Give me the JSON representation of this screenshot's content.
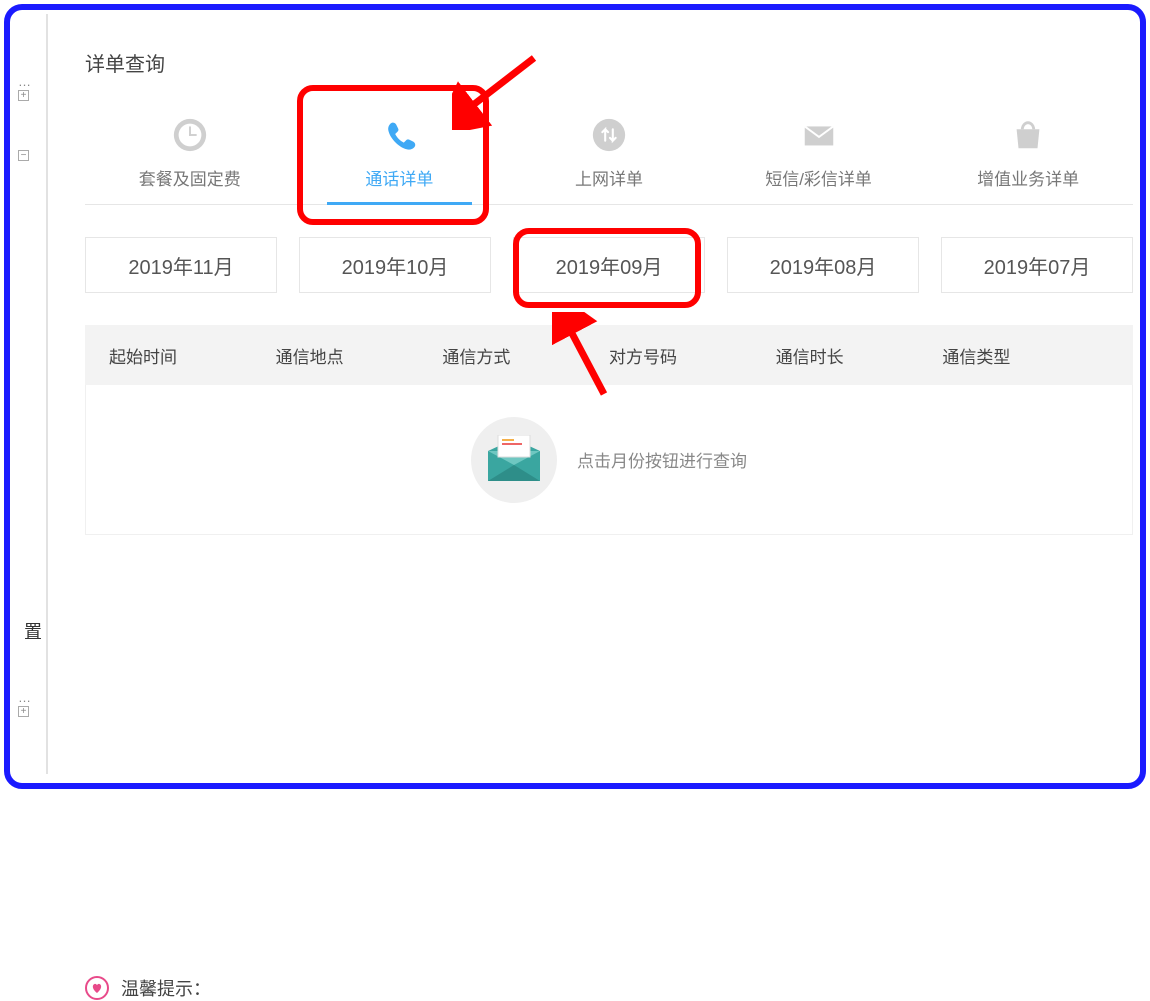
{
  "page_title": "详单查询",
  "category_tabs": [
    {
      "label": "套餐及固定费",
      "icon": "clock-icon",
      "active": false
    },
    {
      "label": "通话详单",
      "icon": "phone-icon",
      "active": true
    },
    {
      "label": "上网详单",
      "icon": "updown-icon",
      "active": false
    },
    {
      "label": "短信/彩信详单",
      "icon": "mail-icon",
      "active": false
    },
    {
      "label": "增值业务详单",
      "icon": "bag-icon",
      "active": false
    }
  ],
  "months": [
    "2019年11月",
    "2019年10月",
    "2019年09月",
    "2019年08月",
    "2019年07月"
  ],
  "table_columns": [
    "起始时间",
    "通信地点",
    "通信方式",
    "对方号码",
    "通信时长",
    "通信类型"
  ],
  "empty_hint": "点击月份按钮进行查询",
  "tips_label": "温馨提示：",
  "sidebar_text": "置"
}
